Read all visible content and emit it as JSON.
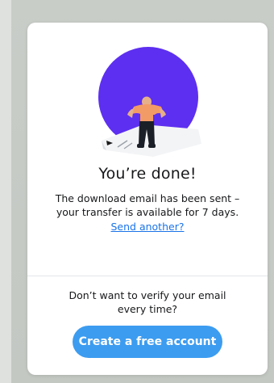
{
  "dialog": {
    "title": "You’re done!",
    "message": "The download email has been sent – your transfer is available for 7 days.",
    "send_another_link": "Send another?",
    "account_prompt": "Don’t want to verify your email every time?",
    "create_account_button": "Create a free account"
  },
  "illustration": {
    "name": "person-jumping-illustration",
    "circle_color": "#5d2ff0"
  },
  "colors": {
    "link": "#1a73e8",
    "button": "#3c9cf0",
    "button_text": "#ffffff",
    "text": "#17181a"
  }
}
